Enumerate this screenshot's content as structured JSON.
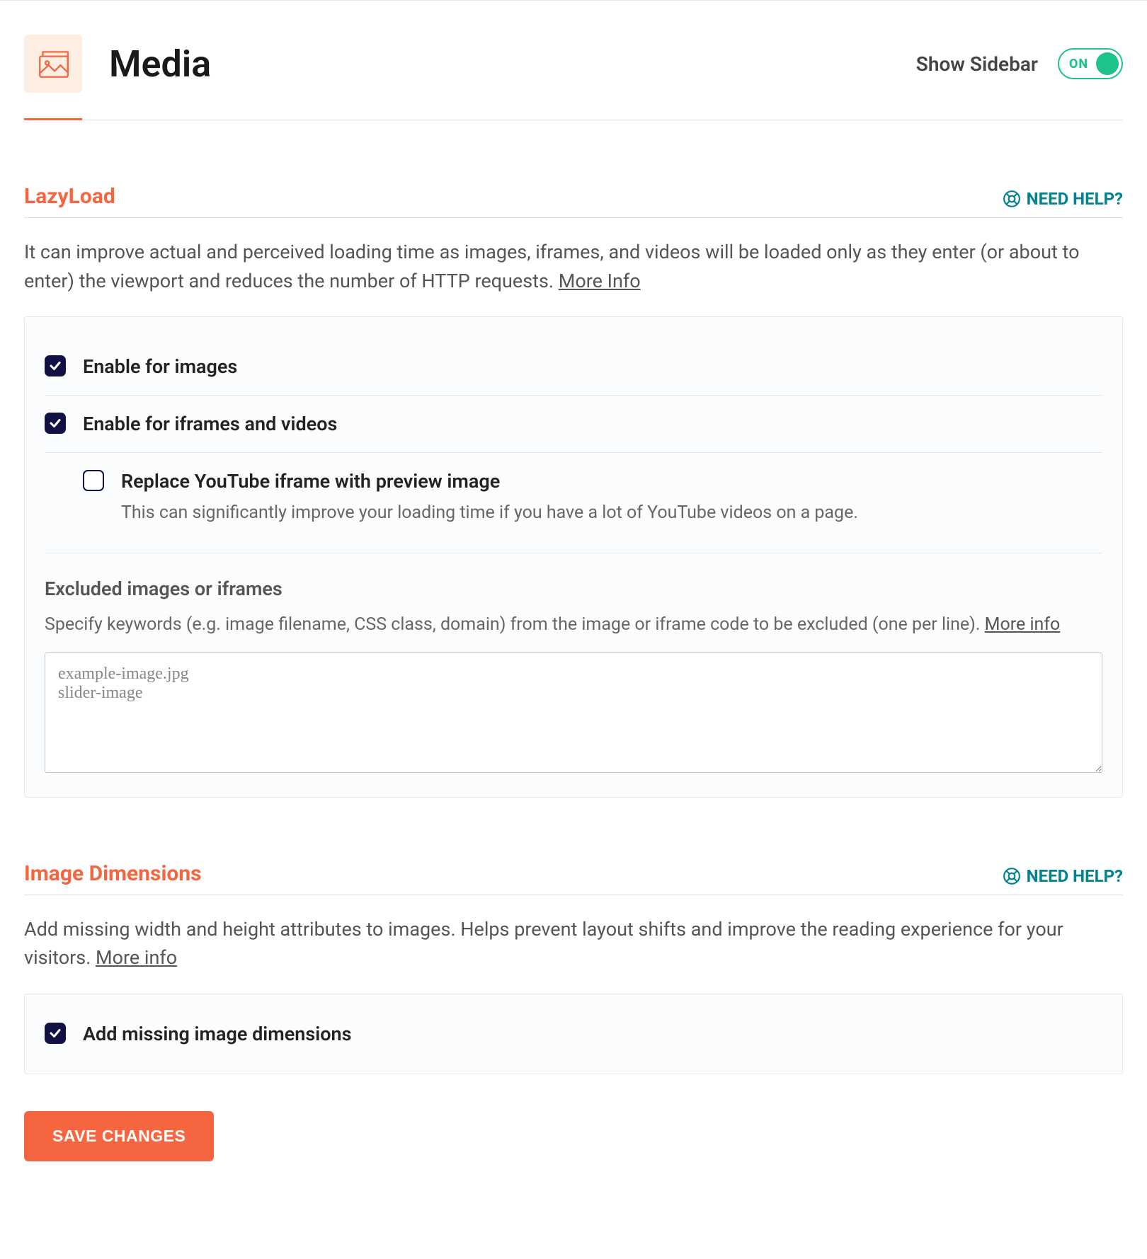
{
  "header": {
    "title": "Media",
    "show_sidebar_label": "Show Sidebar",
    "toggle_label": "ON"
  },
  "help_label": "NEED HELP?",
  "lazyload": {
    "title": "LazyLoad",
    "desc": "It can improve actual and perceived loading time as images, iframes, and videos will be loaded only as they enter (or about to enter) the viewport and reduces the number of HTTP requests. ",
    "more_info": "More Info",
    "enable_images": "Enable for images",
    "enable_iframes": "Enable for iframes and videos",
    "youtube_label": "Replace YouTube iframe with preview image",
    "youtube_sub": "This can significantly improve your loading time if you have a lot of YouTube videos on a page.",
    "excluded_head": "Excluded images or iframes",
    "excluded_desc": "Specify keywords (e.g. image filename, CSS class, domain) from the image or iframe code to be excluded (one per line). ",
    "excluded_more": "More info",
    "excluded_placeholder": "example-image.jpg\nslider-image"
  },
  "imgdim": {
    "title": "Image Dimensions",
    "desc": "Add missing width and height attributes to images. Helps prevent layout shifts and improve the reading experience for your visitors. ",
    "more_info": "More info",
    "add_label": "Add missing image dimensions"
  },
  "save_label": "SAVE CHANGES"
}
